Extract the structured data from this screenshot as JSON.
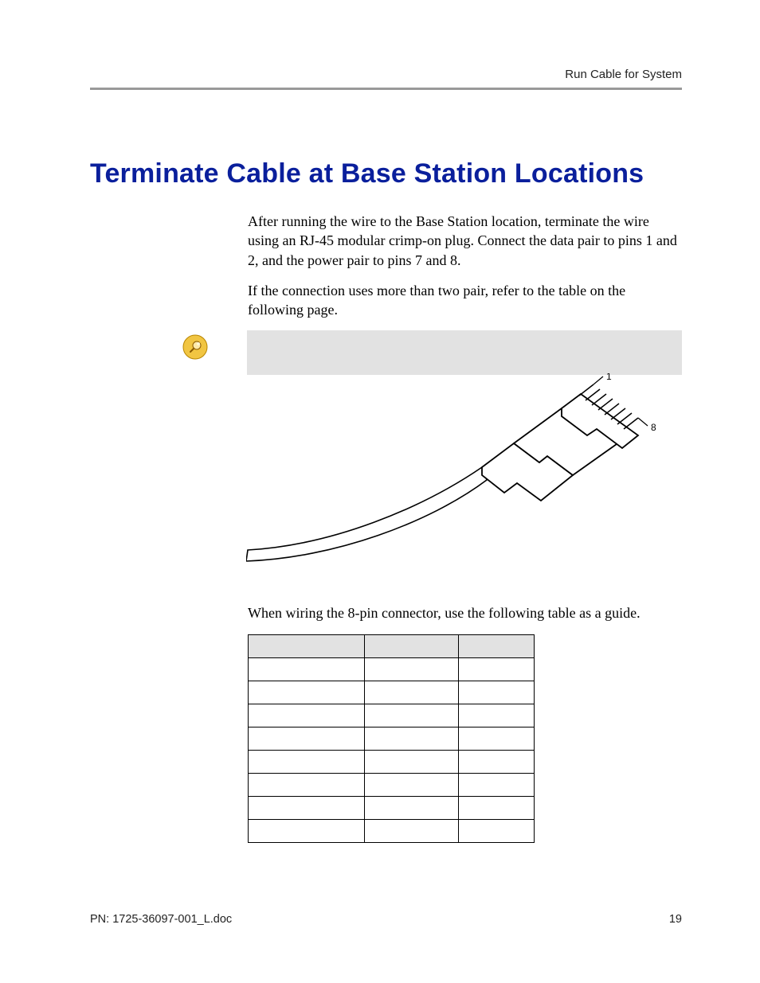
{
  "header": {
    "running_title": "Run Cable for System"
  },
  "title": "Terminate Cable at Base Station Locations",
  "paragraphs": {
    "p1": " After running the wire to the Base Station location, terminate the wire using an RJ-45 modular crimp-on plug. Connect the data pair to pins 1 and 2, and the power pair to pins 7 and 8.",
    "p2": "If the connection uses more than two pair, refer to the table on the following page."
  },
  "figure": {
    "pin_label_top": "1",
    "pin_label_bottom": "8"
  },
  "table_intro": "When wiring the 8-pin connector, use the following table as a guide.",
  "pin_table": {
    "headers": [
      "",
      "",
      ""
    ],
    "rows": [
      [
        "",
        "",
        ""
      ],
      [
        "",
        "",
        ""
      ],
      [
        "",
        "",
        ""
      ],
      [
        "",
        "",
        ""
      ],
      [
        "",
        "",
        ""
      ],
      [
        "",
        "",
        ""
      ],
      [
        "",
        "",
        ""
      ],
      [
        "",
        "",
        ""
      ]
    ]
  },
  "footer": {
    "doc_id": "PN: 1725-36097-001_L.doc",
    "page_no": "19"
  }
}
